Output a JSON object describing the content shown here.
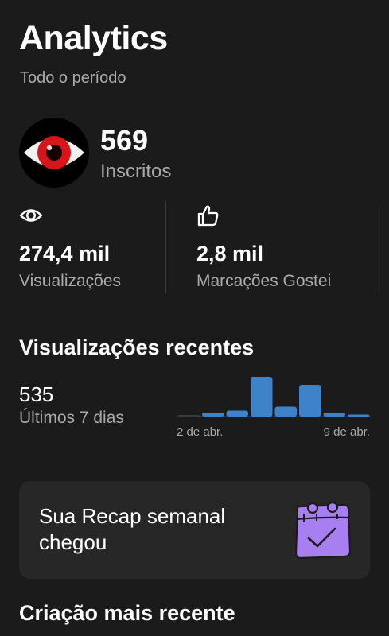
{
  "header": {
    "title": "Analytics",
    "period": "Todo o período"
  },
  "channel": {
    "subscribers_value": "569",
    "subscribers_label": "Inscritos"
  },
  "stats": [
    {
      "icon": "eye-icon",
      "value": "274,4 mil",
      "label": "Visualizações"
    },
    {
      "icon": "thumbs-up-icon",
      "value": "2,8 mil",
      "label": "Marcações Gostei"
    }
  ],
  "recent_views": {
    "title": "Visualizações recentes",
    "value": "535",
    "period_label": "Últimos 7 dias"
  },
  "chart_data": {
    "type": "bar",
    "x_tick_labels": [
      "2 de abr.",
      "9 de abr."
    ],
    "values": [
      0,
      2,
      3,
      20,
      5,
      16,
      2,
      1
    ],
    "bar_color": "#3e82c9"
  },
  "recap": {
    "text_line1": "Sua Recap semanal",
    "text_line2": "chegou",
    "icon": "calendar-check-icon"
  },
  "latest": {
    "title": "Criação mais recente"
  },
  "colors": {
    "background": "#1b1b1b",
    "card": "#272727",
    "secondary_text": "#aaaaaa",
    "accent_purple": "#a77ff0"
  }
}
